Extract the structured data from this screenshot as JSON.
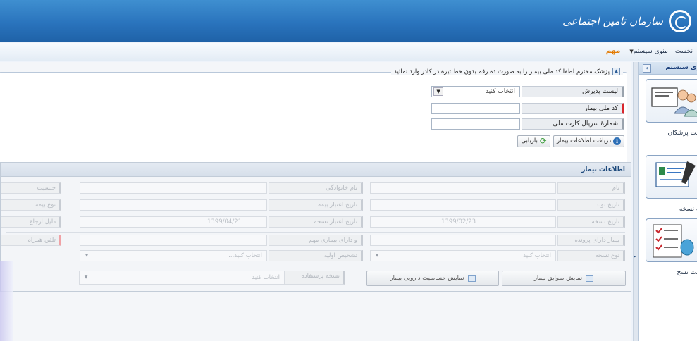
{
  "header": {
    "org_name": "سازمان تامین اجتماعی",
    "brand_color": "#2a74bd"
  },
  "menu": {
    "items": [
      {
        "label": "نخست"
      },
      {
        "label": "منوی سیستم",
        "has_dropdown": true
      },
      {
        "label": "مهم",
        "highlight": true
      }
    ]
  },
  "form": {
    "legend": "پزشک محترم لطفا کد ملی بیمار را به صورت ده رقم بدون خط تیره در کادر وارد نمائید",
    "reception_list_label": "لیست پذیرش",
    "reception_list_value": "انتخاب کنید",
    "national_code_label": "کد ملی بیمار",
    "national_code_value": "",
    "card_serial_label": "شمارهٔ سریال کارت ملی",
    "card_serial_value": "",
    "fetch_button": "دریافت اطلاعات بیمار",
    "reset_button": "بازیابی"
  },
  "patient": {
    "title": "اطلاعات بیمار",
    "row1": [
      "نام",
      "نام خانوادگی",
      "جنسیت"
    ],
    "row2": [
      "تاریخ تولد",
      "تاریخ اعتبار بیمه",
      "نوع بیمه"
    ],
    "row3_labels": [
      "تاریخ نسخه",
      "تاریخ اعتبار نسخه",
      "دلیل ارجاع"
    ],
    "rx_date": "1399/02/23",
    "rx_validity": "1399/04/21",
    "row4": [
      "بیمار دارای پرونده",
      "و دارای بیماری مهم",
      "تلفن همراه"
    ],
    "row5_labels": [
      "نوع نسخه",
      "تشخیص اولیه"
    ],
    "rx_type_value": "انتخاب کنید",
    "diagnosis_value": "انتخاب کنید...",
    "used_rx_label": "نسخه پرستفاده",
    "used_rx_value": "انتخاب کنید",
    "history_button": "نمایش سوابق بیمار",
    "allergy_button": "نمایش حساسیت دارویی بیمار"
  },
  "sidebar": {
    "title": "منوی سیستم",
    "toggle": "«",
    "items": [
      {
        "label": "لیست پزشکان",
        "icon": "doctors-icon"
      },
      {
        "label": "ثبت نسخه",
        "icon": "prescription-write-icon"
      },
      {
        "label": "لیست نسخ",
        "icon": "prescription-list-icon"
      }
    ]
  }
}
